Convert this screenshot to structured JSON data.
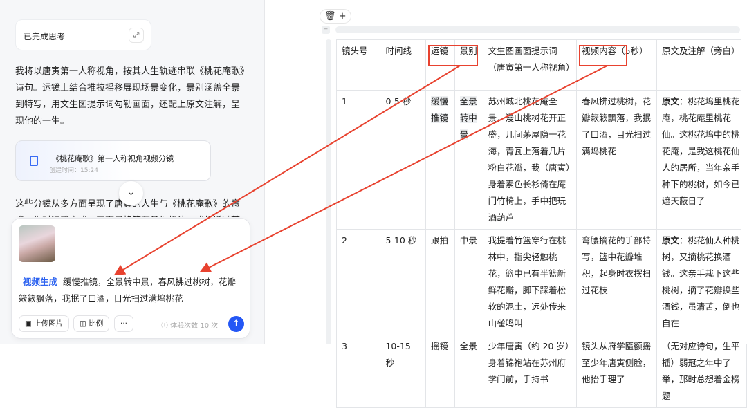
{
  "chat": {
    "thinking_label": "已完成思考",
    "intro": "我将以唐寅第一人称视角，按其人生轨迹串联《桃花庵歌》诗句。运镜上结合推拉摇移展现场景变化，景别涵盖全景到特写，用文生图提示词勾勒画面，还配上原文注解，呈现他的一生。",
    "file": {
      "title": "《桃花庵歌》第一人称视角视频分镜",
      "created": "创建时间：15:24"
    },
    "summary": "这些分镜从多方面呈现了唐寅的人生与《桃花庵歌》的意境，你对运镜方式、画面风格等有其他想法，或想增减某"
  },
  "input": {
    "tag": "视频生成",
    "text": "缓慢推镜，全景转中景，春风拂过桃树，花瓣簌簌飘落，我抿了口酒，目光扫过满坞桃花",
    "upload_label": "上传图片",
    "ratio_label": "比例",
    "more_label": "···",
    "quota": "ⓘ 体验次数 10 次"
  },
  "table": {
    "headers": [
      "镜头号",
      "时间线",
      "运镜",
      "景别",
      "文生图画面提示词（唐寅第一人称视角）",
      "视频内容（5秒）",
      "原文及注解（旁白）"
    ],
    "rows": [
      {
        "no": "1",
        "time": "0-5 秒",
        "camera": "缓慢推镜",
        "shot": "全景转中景",
        "prompt": "苏州城北桃花庵全景，漫山桃树花开正盛，几间茅屋隐于花海，青瓦上落着几片粉白花瓣，我（唐寅）身着素色长衫倚在庵门竹椅上，手中把玩酒葫芦",
        "video": "春风拂过桃树，花瓣簌簌飘落，我抿了口酒，目光扫过满坞桃花",
        "orig_label": "原文",
        "orig": "：桃花坞里桃花庵，桃花庵里桃花仙。这桃花坞中的桃花庵，是我这桃花仙人的居所，当年亲手种下的桃树，如今已遮天蔽日了"
      },
      {
        "no": "2",
        "time": "5-10 秒",
        "camera": "跟拍",
        "shot": "中景",
        "prompt": "我提着竹篮穿行在桃林中，指尖轻触桃花，篮中已有半篮新鲜花瓣，脚下踩着松软的泥土，远处传来山雀鸣叫",
        "video": "弯腰摘花的手部特写，篮中花瓣堆积，起身时衣摆扫过花枝",
        "orig_label": "原文",
        "orig": "：桃花仙人种桃树，又摘桃花换酒钱。这亲手栽下这些桃树，摘了花瓣换些酒钱，虽清苦，倒也自在"
      },
      {
        "no": "3",
        "time": "10-15 秒",
        "camera": "摇镜",
        "shot": "全景",
        "prompt": "少年唐寅（约 20 岁）身着锦袍站在苏州府学门前，手持书",
        "video": "镜头从府学匾额摇至少年唐寅侧脸，他抬手理了",
        "orig_label": "",
        "orig": "（无对应诗句，生平插）弱冠之年中了举，那时总想着金榜题"
      }
    ]
  },
  "annotation_color": "#e8422f",
  "accent": "#2457f5"
}
